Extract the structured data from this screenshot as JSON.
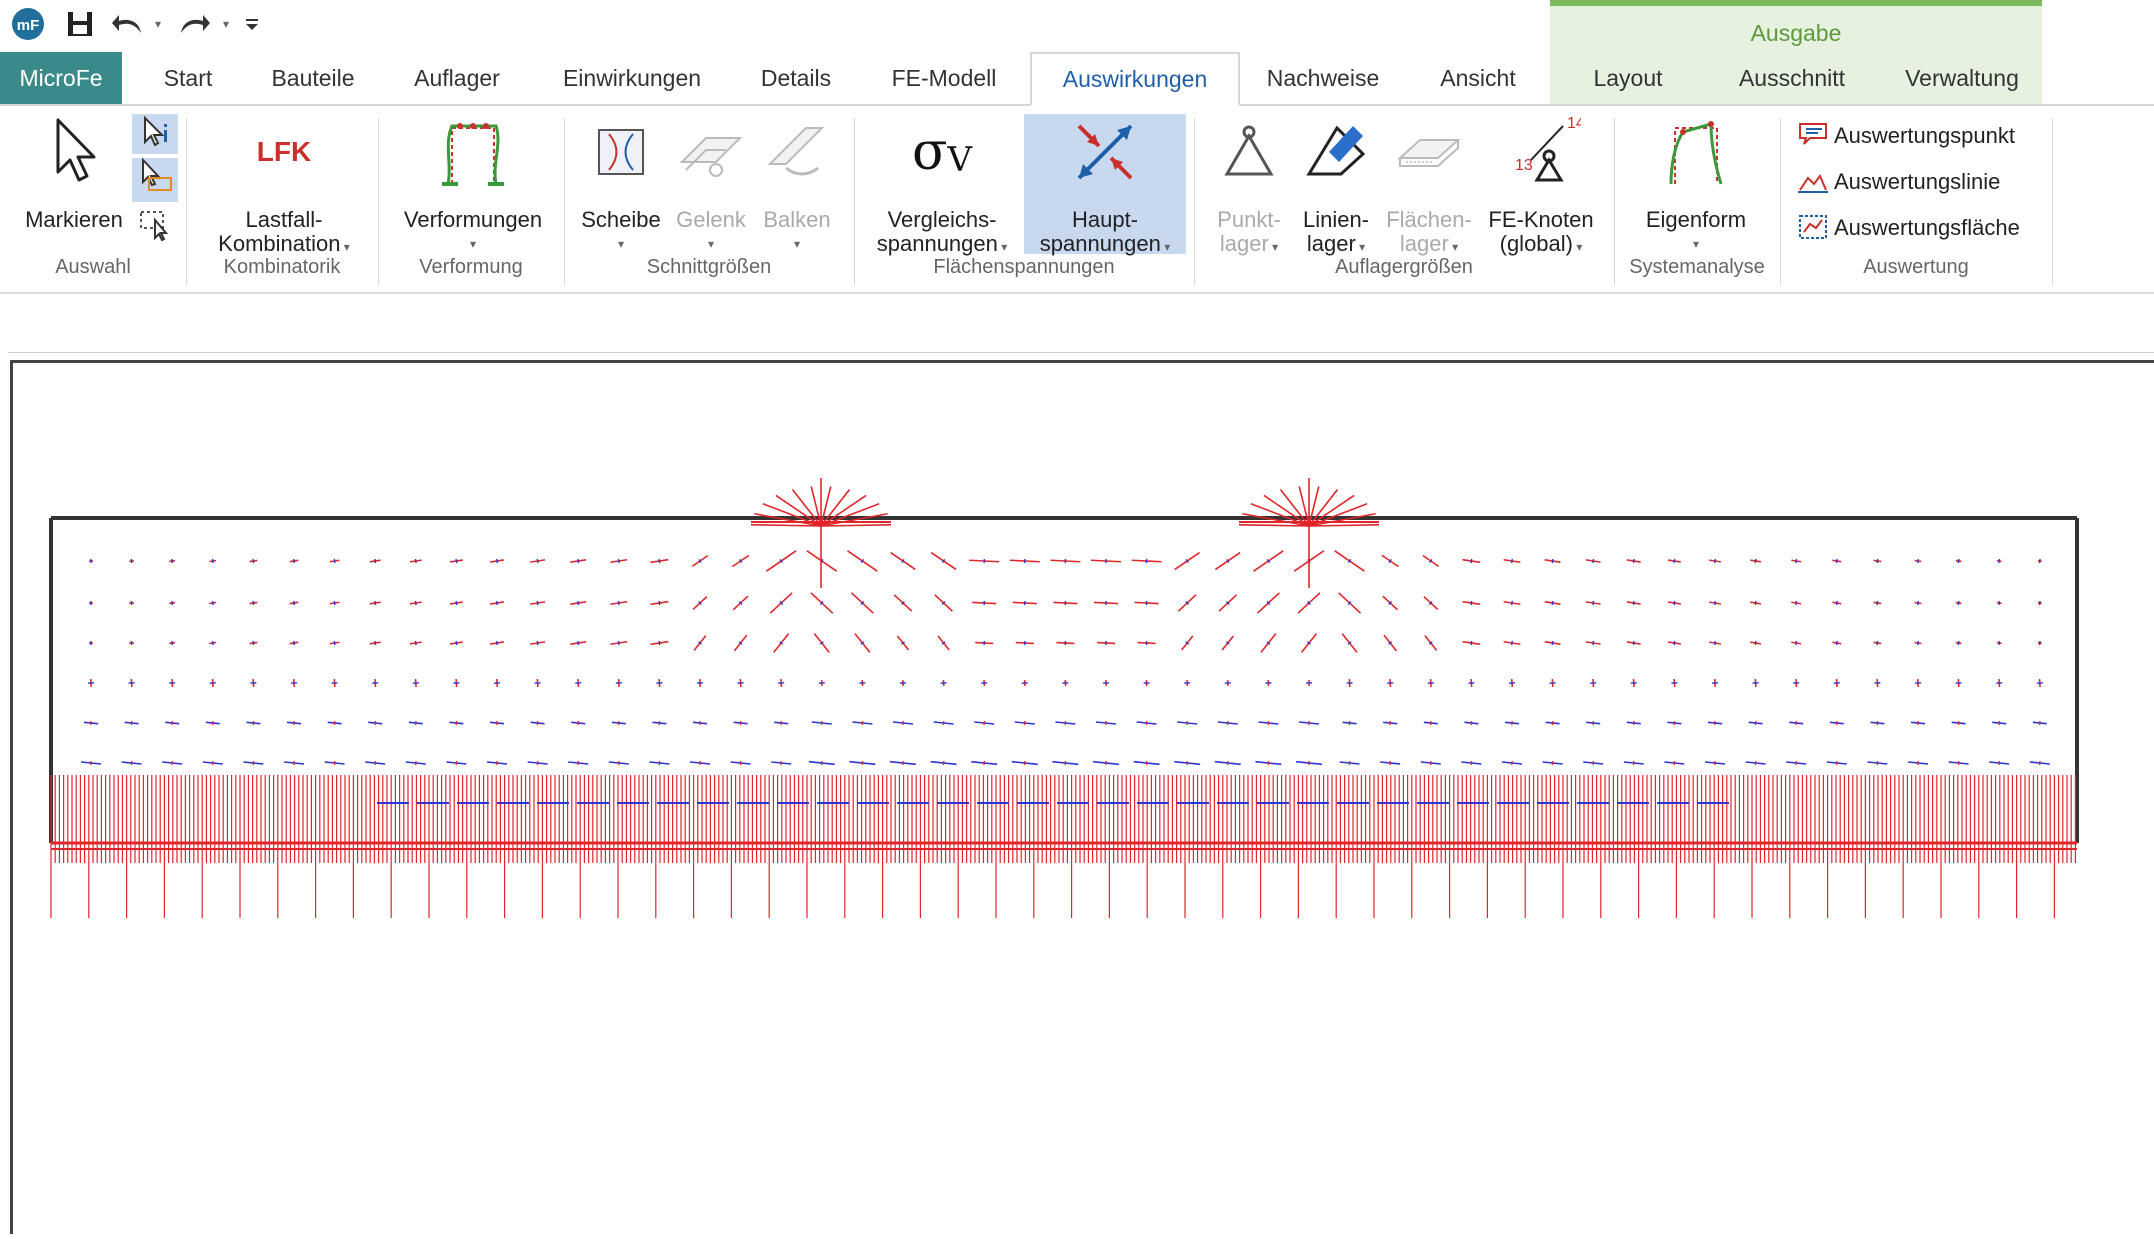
{
  "quick_access": {
    "logo": "MicroFe-logo",
    "icons": [
      "save-icon",
      "undo-icon",
      "redo-icon",
      "customize-icon"
    ]
  },
  "tabs": [
    {
      "label": "MicroFe",
      "type": "file"
    },
    {
      "label": "Start"
    },
    {
      "label": "Bauteile"
    },
    {
      "label": "Auflager"
    },
    {
      "label": "Einwirkungen"
    },
    {
      "label": "Details"
    },
    {
      "label": "FE-Modell"
    },
    {
      "label": "Auswirkungen",
      "active": true
    },
    {
      "label": "Nachweise"
    },
    {
      "label": "Ansicht"
    }
  ],
  "context_tabs": {
    "title": "Ausgabe",
    "tabs": [
      "Layout",
      "Ausschnitt",
      "Verwaltung"
    ],
    "color": "#7cb95c"
  },
  "ribbon": {
    "auswahl": {
      "label": "Auswahl",
      "markieren": "Markieren"
    },
    "kombinatorik": {
      "label": "Kombinatorik",
      "lfk_icon": "LFK",
      "btn_line1": "Lastfall-",
      "btn_line2": "Kombination"
    },
    "verformung": {
      "label": "Verformung",
      "btn": "Verformungen"
    },
    "schnittgroessen": {
      "label": "Schnittgrößen",
      "scheibe": "Scheibe",
      "gelenk": "Gelenk",
      "balken": "Balken"
    },
    "flaechenspannungen": {
      "label": "Flächenspannungen",
      "sigma": "σ",
      "sigma_sub": "V",
      "vergleich_1": "Vergleichs-",
      "vergleich_2": "spannungen",
      "haupt_1": "Haupt-",
      "haupt_2": "spannungen"
    },
    "auflagergroessen": {
      "label": "Auflagergrößen",
      "punkt_1": "Punkt-",
      "punkt_2": "lager",
      "linien_1": "Linien-",
      "linien_2": "lager",
      "flaechen_1": "Flächen-",
      "flaechen_2": "lager",
      "fe_1": "FE-Knoten",
      "fe_2": "(global)",
      "node_a": "14",
      "node_b": "13"
    },
    "systemanalyse": {
      "label": "Systemanalyse",
      "btn": "Eigenform"
    },
    "auswertung": {
      "label": "Auswertung",
      "punkt": "Auswertungspunkt",
      "linie": "Auswertungslinie",
      "flaeche": "Auswertungsfläche"
    }
  },
  "plot": {
    "tension_color": "#e0262a",
    "compression_color": "#2b35d6",
    "frame_color": "#333333"
  }
}
